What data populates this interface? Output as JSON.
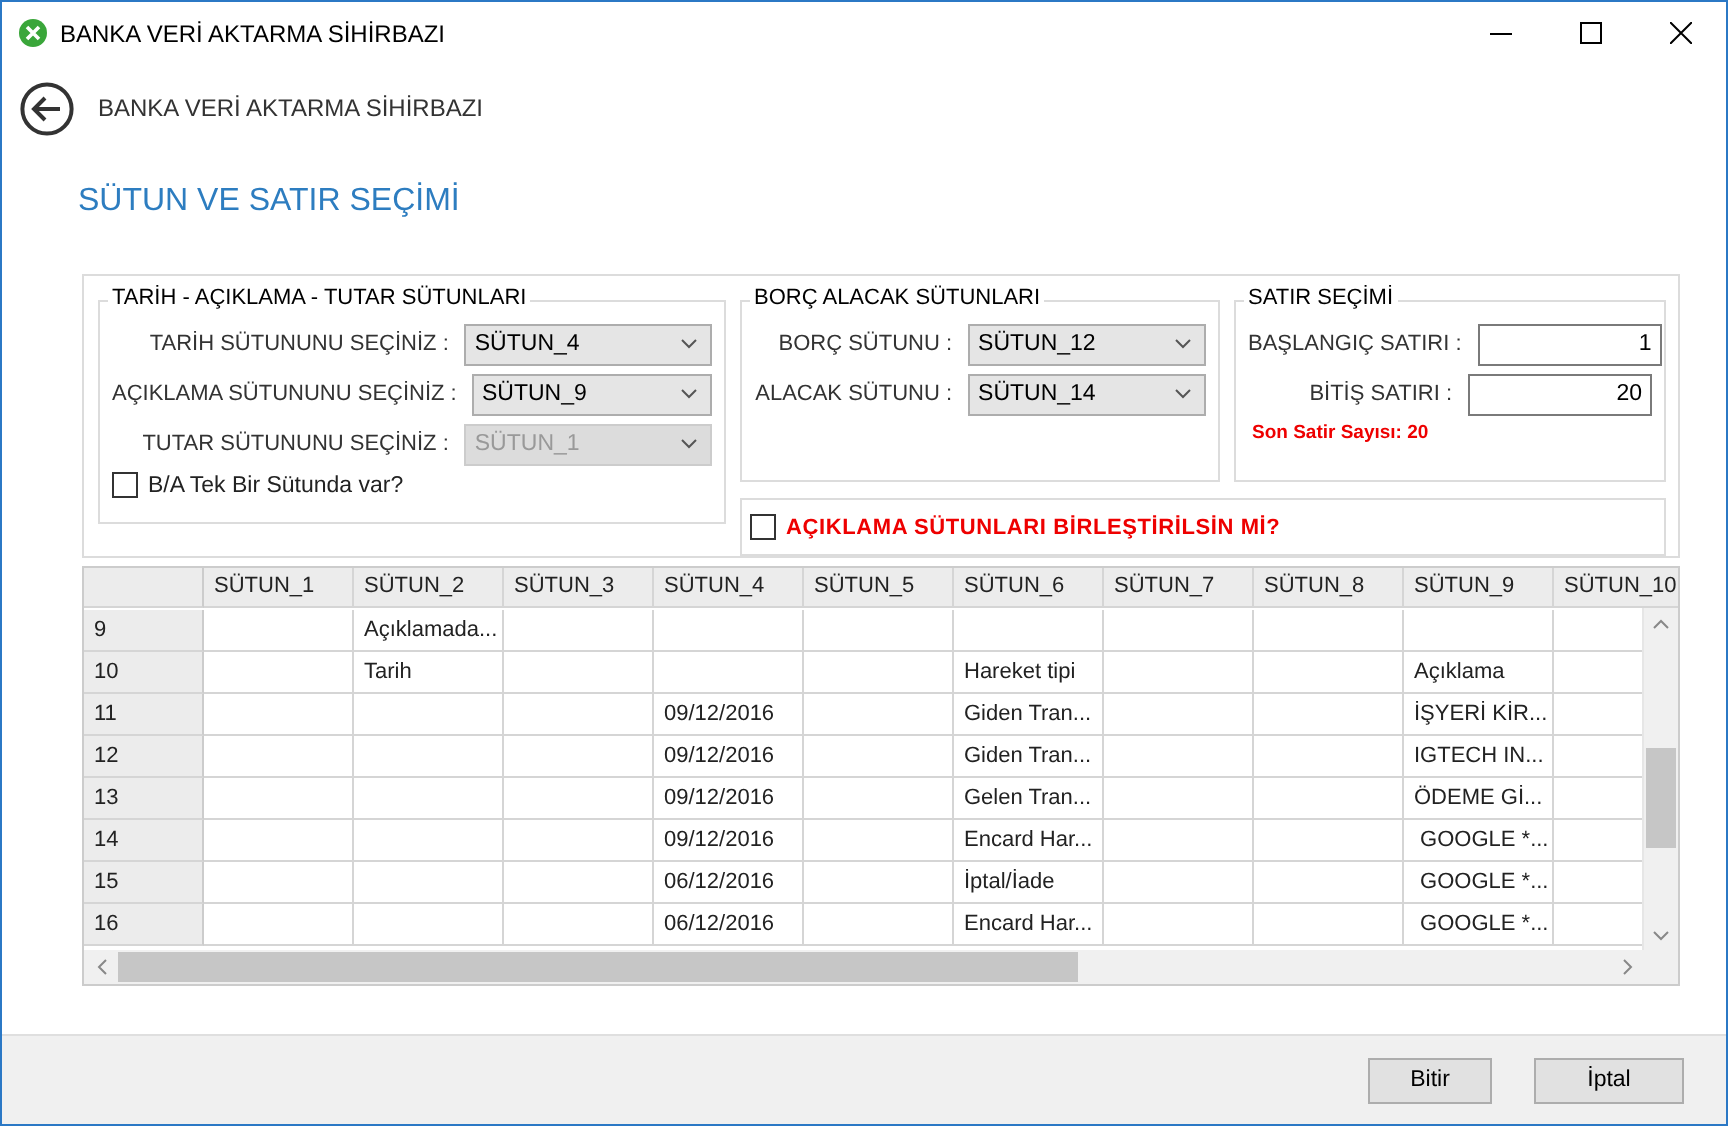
{
  "window": {
    "title": "BANKA VERİ AKTARMA SİHİRBAZI"
  },
  "header": {
    "title": "BANKA VERİ AKTARMA SİHİRBAZI"
  },
  "page_title": "SÜTUN VE SATIR SEÇİMİ",
  "column_group": {
    "title": "TARİH - AÇIKLAMA - TUTAR SÜTUNLARI",
    "fields": [
      {
        "label": "TARİH SÜTUNUNU SEÇİNİZ :",
        "value": "SÜTUN_4",
        "disabled": false
      },
      {
        "label": "AÇIKLAMA SÜTUNUNU SEÇİNİZ :",
        "value": "SÜTUN_9",
        "disabled": false
      },
      {
        "label": "TUTAR SÜTUNUNU SEÇİNİZ :",
        "value": "SÜTUN_1",
        "disabled": true
      }
    ],
    "checkbox": {
      "label": "B/A Tek Bir Sütunda var?",
      "checked": false
    }
  },
  "debit_credit_group": {
    "title": "BORÇ ALACAK SÜTUNLARI",
    "fields": [
      {
        "label": "BORÇ SÜTUNU :",
        "value": "SÜTUN_12",
        "disabled": false
      },
      {
        "label": "ALACAK SÜTUNU :",
        "value": "SÜTUN_14",
        "disabled": false
      }
    ]
  },
  "row_group": {
    "title": "SATIR SEÇİMİ",
    "fields": [
      {
        "label": "BAŞLANGIÇ SATIRI :",
        "value": "1"
      },
      {
        "label": "BİTİŞ SATIRI :",
        "value": "20"
      }
    ],
    "note": "Son Satir Sayısı: 20"
  },
  "merge_checkbox": {
    "label": "AÇIKLAMA SÜTUNLARI BİRLEŞTİRİLSİN Mİ?",
    "checked": false
  },
  "grid": {
    "columns": [
      "SÜTUN_1",
      "SÜTUN_2",
      "SÜTUN_3",
      "SÜTUN_4",
      "SÜTUN_5",
      "SÜTUN_6",
      "SÜTUN_7",
      "SÜTUN_8",
      "SÜTUN_9",
      "SÜTUN_10"
    ],
    "rows": [
      {
        "label": "9",
        "cells": [
          null,
          "Açıklamada...",
          null,
          null,
          null,
          null,
          null,
          null,
          null,
          null
        ]
      },
      {
        "label": "10",
        "cells": [
          null,
          "Tarih",
          null,
          null,
          null,
          "Hareket tipi",
          null,
          null,
          "Açıklama",
          null
        ]
      },
      {
        "label": "11",
        "cells": [
          null,
          null,
          null,
          "09/12/2016",
          null,
          "Giden Tran...",
          null,
          null,
          "İŞYERİ KİR...",
          null
        ]
      },
      {
        "label": "12",
        "cells": [
          null,
          null,
          null,
          "09/12/2016",
          null,
          "Giden Tran...",
          null,
          null,
          "IGTECH IN...",
          null
        ]
      },
      {
        "label": "13",
        "cells": [
          null,
          null,
          null,
          "09/12/2016",
          null,
          "Gelen Tran...",
          null,
          null,
          "ÖDEME Gİ...",
          null
        ]
      },
      {
        "label": "14",
        "cells": [
          null,
          null,
          null,
          "09/12/2016",
          null,
          "Encard Har...",
          null,
          null,
          " GOOGLE *...",
          null
        ]
      },
      {
        "label": "15",
        "cells": [
          null,
          null,
          null,
          "06/12/2016",
          null,
          "İptal/İade",
          null,
          null,
          " GOOGLE *...",
          null
        ]
      },
      {
        "label": "16",
        "cells": [
          null,
          null,
          null,
          "06/12/2016",
          null,
          "Encard Har...",
          null,
          null,
          " GOOGLE *...",
          null
        ]
      }
    ]
  },
  "buttons": [
    {
      "label": "Bitir"
    },
    {
      "label": "İptal"
    }
  ]
}
